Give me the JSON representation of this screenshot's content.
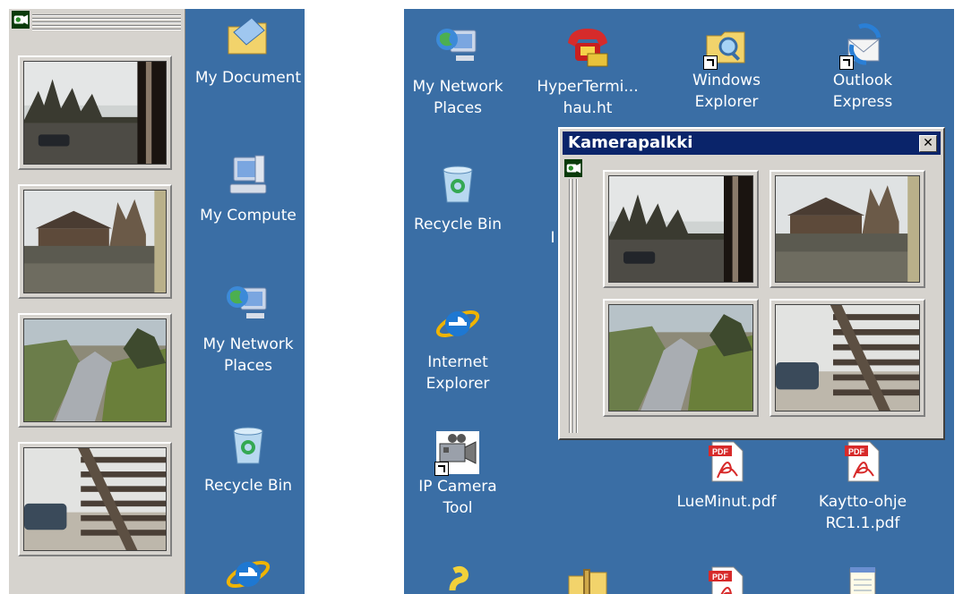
{
  "left_panel": {
    "desktop_icons": [
      {
        "icon": "folder-documents-icon",
        "label": "My Document"
      },
      {
        "icon": "computer-icon",
        "label": "My Compute"
      },
      {
        "icon": "network-places-icon",
        "label": "My Network\nPlaces"
      },
      {
        "icon": "recycle-bin-icon",
        "label": "Recycle Bin"
      },
      {
        "icon": "internet-explorer-icon",
        "label": ""
      }
    ],
    "thumbnails": [
      {
        "subject": "window-view-car"
      },
      {
        "subject": "street-houses"
      },
      {
        "subject": "garden-path"
      },
      {
        "subject": "fence-car"
      }
    ]
  },
  "right_panel": {
    "desktop_icons": [
      {
        "icon": "network-places-icon",
        "label": "My Network\nPlaces"
      },
      {
        "icon": "hyperterminal-icon",
        "label": "HyperTermi...\nhau.ht"
      },
      {
        "icon": "windows-explorer-icon",
        "label": "Windows\nExplorer"
      },
      {
        "icon": "outlook-express-icon",
        "label": "Outlook\nExpress"
      },
      {
        "icon": "recycle-bin-icon",
        "label": "Recycle Bin"
      },
      {
        "icon": "internet-explorer-icon",
        "label": "Internet\nExplorer"
      },
      {
        "icon": "ip-camera-tool-icon",
        "label": "IP Camera\nTool"
      },
      {
        "icon": "pdf-icon",
        "label": "LueMinut.pdf"
      },
      {
        "icon": "pdf-icon",
        "label": "Kaytto-ohje\nRC1.1.pdf"
      },
      {
        "icon": "help-icon",
        "label": ""
      },
      {
        "icon": "zip-folder-icon",
        "label": ""
      },
      {
        "icon": "pdf-icon",
        "label": ""
      },
      {
        "icon": "notepad-icon",
        "label": ""
      }
    ],
    "partial_label": "I",
    "window": {
      "title": "Kamerapalkki",
      "close_glyph": "✕"
    }
  },
  "colors": {
    "desktop": "#3a6ea5",
    "panel": "#d6d3ce",
    "titlebar": "#0a246a"
  }
}
